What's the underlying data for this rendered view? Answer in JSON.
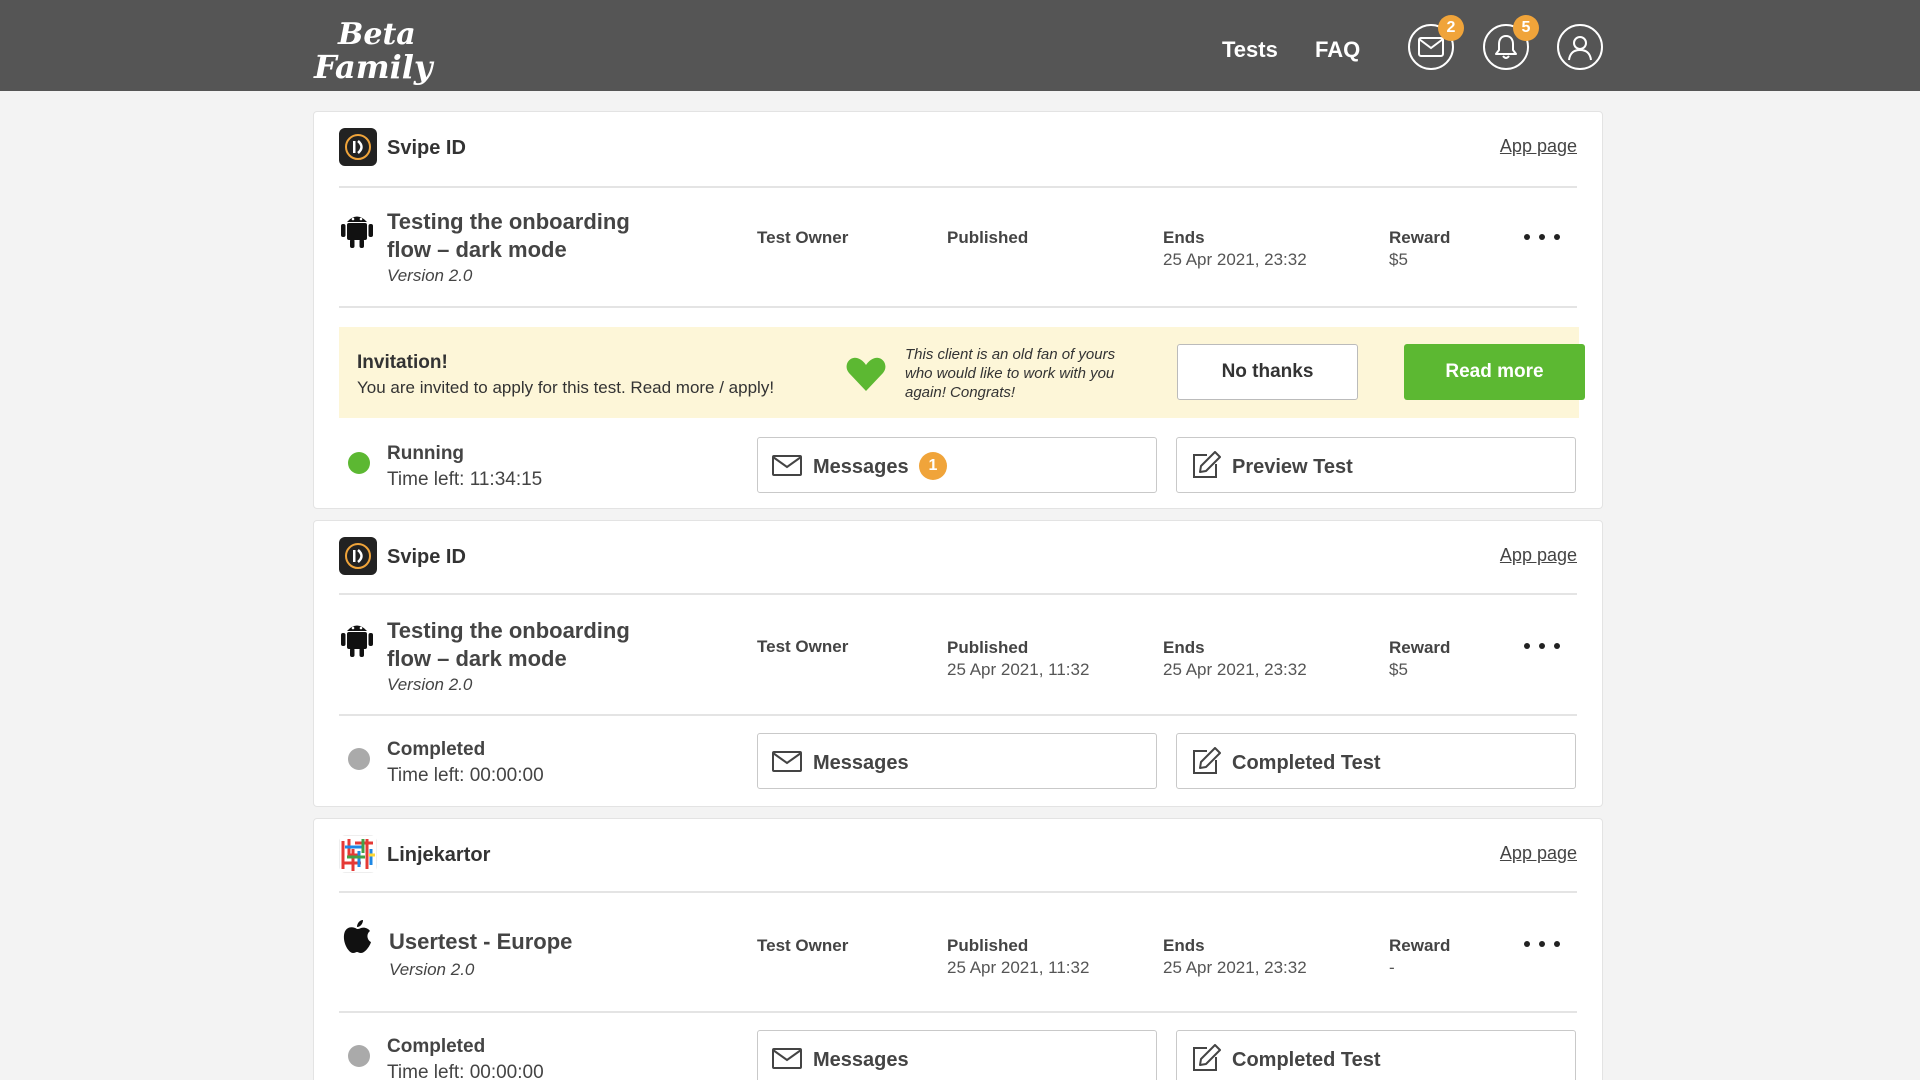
{
  "header": {
    "logo_line1": "Beta",
    "logo_line2": "Family",
    "nav": {
      "tests": "Tests",
      "faq": "FAQ"
    },
    "mail_count": "2",
    "notification_count": "5"
  },
  "labels": {
    "test_owner": "Test Owner",
    "published": "Published",
    "ends": "Ends",
    "reward": "Reward",
    "app_page": "App page",
    "messages": "Messages"
  },
  "cards": [
    {
      "app_name": "Svipe ID",
      "platform": "android",
      "title_line1": "Testing the onboarding",
      "title_line2": "flow – dark mode",
      "version": "Version 2.0",
      "published_value": "",
      "ends_value": "25 Apr 2021, 23:32",
      "reward_value": "$5",
      "invitation": {
        "title": "Invitation!",
        "text": "You are invited to apply for this test. Read more / apply!",
        "note_line1": "This client is an old fan of yours",
        "note_line2": "who would like to work with you",
        "note_line3": "again! Congrats!",
        "decline_label": "No thanks",
        "accept_label": "Read more"
      },
      "status": "Running",
      "status_color": "#5cb832",
      "time_left": "Time left: 11:34:15",
      "messages_count": "1",
      "test_button": "Preview Test"
    },
    {
      "app_name": "Svipe ID",
      "platform": "android",
      "title_line1": "Testing the onboarding",
      "title_line2": "flow – dark mode",
      "version": "Version 2.0",
      "published_value": "25 Apr 2021, 11:32",
      "ends_value": "25 Apr 2021, 23:32",
      "reward_value": "$5",
      "status": "Completed",
      "status_color": "#aaaaaa",
      "time_left": "Time left: 00:00:00",
      "test_button": "Completed Test"
    },
    {
      "app_name": "Linjekartor",
      "platform": "ios",
      "title_line1": "Usertest - Europe",
      "version": "Version 2.0",
      "published_value": "25 Apr 2021, 11:32",
      "ends_value": "25 Apr 2021, 23:32",
      "reward_value": "-",
      "status": "Completed",
      "status_color": "#aaaaaa",
      "time_left": "Time left: 00:00:00",
      "test_button": "Completed Test"
    }
  ],
  "colors": {
    "header_bg": "#555555",
    "accent_green": "#5cb832",
    "badge_orange": "#f0a43a",
    "invite_bg": "#fdf6d8"
  },
  "icons": [
    "mail-icon",
    "bell-icon",
    "user-icon",
    "android-icon",
    "apple-icon",
    "heart-icon",
    "edit-icon",
    "more-icon"
  ]
}
